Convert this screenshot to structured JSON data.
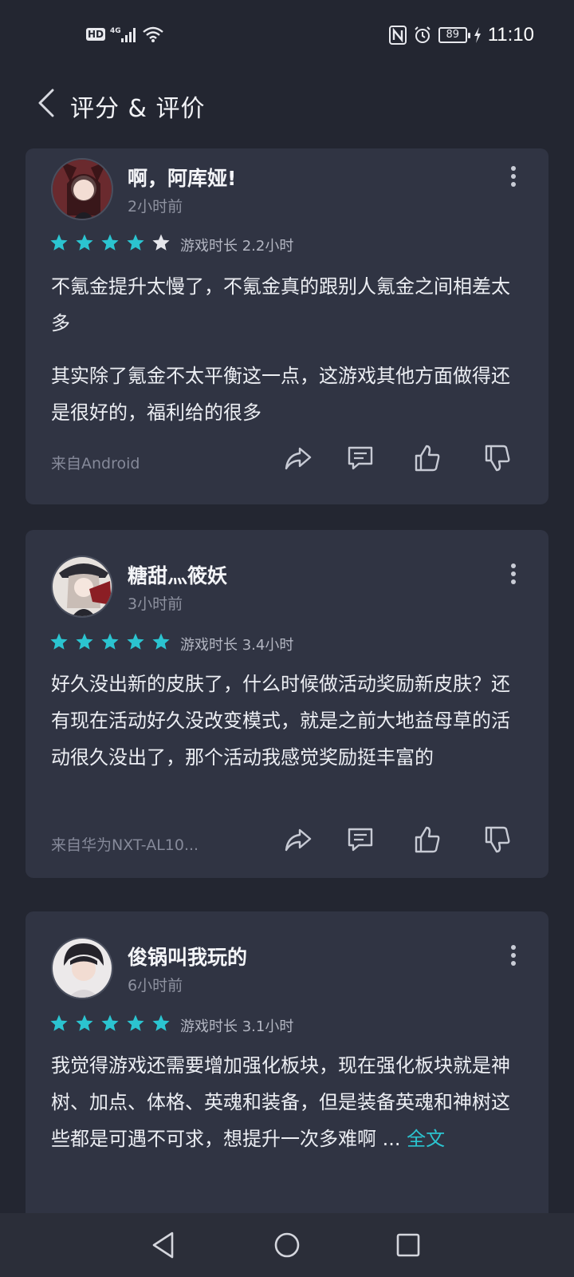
{
  "status_bar": {
    "hd": "HD",
    "network": "4G",
    "battery": "89",
    "time": "11:10"
  },
  "header": {
    "title": "评分 & 评价",
    "back_icon": "chevron-left-icon"
  },
  "colors": {
    "background": "#232631",
    "card": "#303443",
    "star_filled": "#2bc4d0",
    "star_empty": "#e6e7ec",
    "link": "#2bc4d0"
  },
  "reviews": [
    {
      "username": "啊，阿库娅!",
      "time_ago": "2小时前",
      "rating": 4,
      "max_rating": 5,
      "play_time": "游戏时长 2.2小时",
      "text_lines": [
        "不氪金提升太慢了，不氪金真的跟别人氪金之间相差太多",
        "其实除了氪金不太平衡这一点，这游戏其他方面做得还是很好的，福利给的很多"
      ],
      "source": "来自Android"
    },
    {
      "username": "糖甜灬筱妖",
      "time_ago": "3小时前",
      "rating": 5,
      "max_rating": 5,
      "play_time": "游戏时长 3.4小时",
      "text_lines": [
        "好久没出新的皮肤了，什么时候做活动奖励新皮肤？还有现在活动好久没改变模式，就是之前大地益母草的活动很久没出了，那个活动我感觉奖励挺丰富的"
      ],
      "source": "来自华为NXT-AL10..."
    },
    {
      "username": "俊锅叫我玩的",
      "time_ago": "6小时前",
      "rating": 5,
      "max_rating": 5,
      "play_time": "游戏时长 3.1小时",
      "text_lines": [
        "我觉得游戏还需要增加强化板块，现在强化板块就是神树、加点、体格、英魂和装备，但是装备英魂和神树这些都是可遇不可求，想提升一次多难啊 ..."
      ],
      "more_link": "全文"
    }
  ],
  "nav": {
    "back": "back-triangle-icon",
    "home": "home-circle-icon",
    "recents": "recents-square-icon"
  }
}
